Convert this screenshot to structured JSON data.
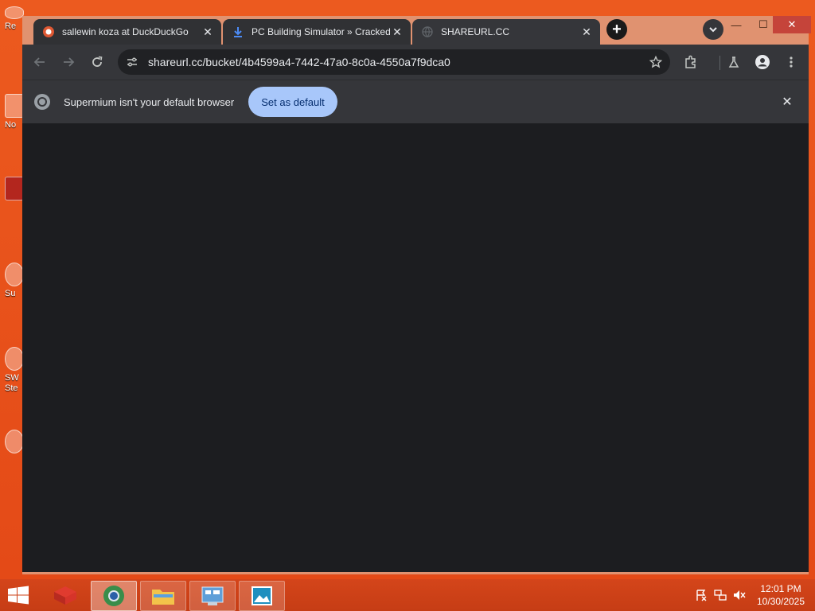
{
  "desktop": {
    "icons": [
      {
        "label": "Re",
        "icon": "recycle-bin-icon"
      },
      {
        "label": "No",
        "icon": "notepad-icon"
      },
      {
        "label": "",
        "icon": "app-icon"
      },
      {
        "label": "Su",
        "icon": "supermium-icon"
      },
      {
        "label": "SW\nSte",
        "icon": "steam-icon"
      },
      {
        "label": "",
        "icon": "app-icon"
      }
    ]
  },
  "browser": {
    "tabs": [
      {
        "title": "sallewin koza at DuckDuckGo",
        "icon": "duckduckgo-icon",
        "active": false
      },
      {
        "title": "PC Building Simulator » Cracked",
        "icon": "download-icon",
        "active": false
      },
      {
        "title": "SHAREURL.CC",
        "icon": "globe-icon",
        "active": true
      }
    ],
    "new_tab": "+",
    "window_controls": {
      "minimize": "—",
      "maximize": "☐",
      "close": "✕"
    },
    "address": "shareurl.cc/bucket/4b4599a4-7442-47a0-8c0a-4550a7f9dca0",
    "infobar": {
      "message": "Supermium isn't your default browser",
      "button": "Set as default"
    }
  },
  "taskbar": {
    "apps": [
      {
        "name": "app-launcher",
        "icon": "red-box-icon"
      },
      {
        "name": "supermium",
        "icon": "supermium-icon",
        "active": true
      },
      {
        "name": "file-explorer",
        "icon": "folder-icon"
      },
      {
        "name": "control-panel",
        "icon": "control-panel-icon"
      },
      {
        "name": "photos",
        "icon": "picture-icon"
      }
    ],
    "clock": {
      "time": "12:01 PM",
      "date": "10/30/2025"
    }
  },
  "colors": {
    "desktop": "#e8521b",
    "tab_bg": "#303134",
    "content_bg": "#1c1d20",
    "infobar_button": "#a8c7fa"
  }
}
